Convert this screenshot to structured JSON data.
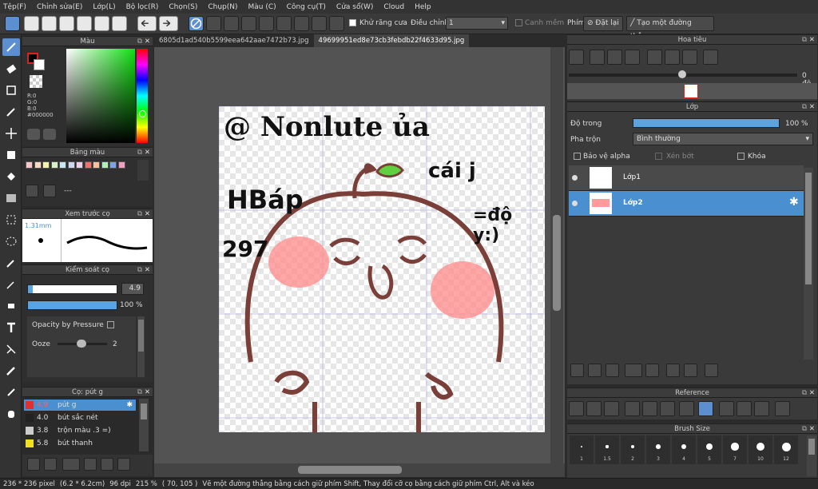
{
  "menu": [
    "Tệp(F)",
    "Chỉnh sửa(E)",
    "Lớp(L)",
    "Bộ lọc(R)",
    "Chọn(S)",
    "Chụp(N)",
    "Màu (C)",
    "Công cụ(T)",
    "Cửa sổ(W)",
    "Cloud",
    "Help"
  ],
  "toolbar": {
    "antialias_label": "Khử răng cưa",
    "adjust_label": "Điều chỉnh",
    "adjust_value": "1",
    "snap_label": "Canh mềm",
    "pen_label": "Phím",
    "reset_label": "Đặt lại",
    "line_label": "Tạo một đường thẳng"
  },
  "tabs": [
    "6805d1ad540b5599eea642aae7472b73.jpg",
    "49699951ed8e73cb3febdb22f4633d95.jpg"
  ],
  "color_panel": {
    "title": "Màu",
    "r": "R:0",
    "g": "G:0",
    "b": "B:0",
    "hex": "#000000"
  },
  "palette_panel": {
    "title": "Bảng màu",
    "swatches": [
      "#f4c8c8",
      "#f8d8c0",
      "#f8f0b0",
      "#d8f0c8",
      "#c8e8f0",
      "#d0d8f0",
      "#f0d0e8",
      "#f07070",
      "#f8c0a0",
      "#b0f0b0",
      "#80a0f0",
      "#f0a0c0"
    ],
    "value": "---"
  },
  "preview_panel": {
    "title": "Xem trước cọ",
    "size": "1.31mm"
  },
  "control_panel": {
    "title": "Kiểm soát cọ",
    "size_value": "4.9",
    "opacity_value": "100 %",
    "pressure_label": "Opacity by Pressure",
    "ooze_label": "Ooze",
    "ooze_value": "2",
    "size_level": 0.05,
    "opacity_level": 1.0
  },
  "brush_panel": {
    "title": "Cọ: pút g",
    "items": [
      {
        "size": "4.9",
        "name": "pút g",
        "color": "#e03030",
        "selected": true
      },
      {
        "size": "4.0",
        "name": "bút sắc nét",
        "color": "#222222",
        "selected": false
      },
      {
        "size": "3.8",
        "name": "trộn màu .3 =)",
        "color": "#cccccc",
        "selected": false
      },
      {
        "size": "5.8",
        "name": "bút thanh",
        "color": "#f0e020",
        "selected": false
      }
    ]
  },
  "navigator": {
    "title": "Hoa tiêu",
    "angle": "0 độ"
  },
  "layer_panel": {
    "title": "Lớp",
    "opacity_label": "Độ trong",
    "opacity_value": "100 %",
    "opacity_level": 1.0,
    "blend_label": "Pha trộn",
    "blend_value": "Bình thường",
    "protect_label": "Bảo vệ alpha",
    "clip_label": "Xén bớt",
    "lock_label": "Khóa",
    "layers": [
      {
        "name": "Lớp1",
        "selected": false
      },
      {
        "name": "Lớp2",
        "selected": true
      }
    ]
  },
  "reference": {
    "title": "Reference"
  },
  "brush_size": {
    "title": "Brush Size",
    "sizes": [
      "1",
      "1.5",
      "2",
      "3",
      "4",
      "5",
      "7",
      "10",
      "12"
    ]
  },
  "status": {
    "dims": "236 * 236 pixel",
    "cm": "(6.2 * 6.2cm)",
    "dpi": "96 dpi",
    "zoom": "215 %",
    "coords": "( 70, 105 )",
    "hint": "Vẽ một đường thẳng bằng cách giữ phím Shift, Thay đổi cỡ cọ bằng cách giữ phím Ctrl, Alt và kéo"
  },
  "canvas_text": {
    "line1": "@ Nonlute ủa",
    "line2": "cái j",
    "line3": "HBáp",
    "line4": "=độ y:)",
    "line5": "297"
  }
}
